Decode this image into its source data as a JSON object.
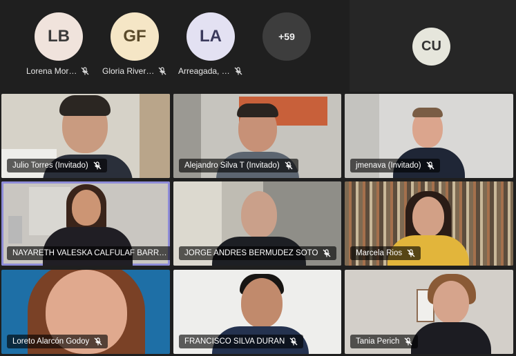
{
  "top_participants": [
    {
      "initials": "LB",
      "name": "Lorena Mor…",
      "color": "#f0e3dc"
    },
    {
      "initials": "GF",
      "name": "Gloria River…",
      "color": "#f5e6c6"
    },
    {
      "initials": "LA",
      "name": "Arreagada, …",
      "color": "#e3e1f2"
    }
  ],
  "more_count": "+59",
  "self_initials": "CU",
  "tiles": [
    {
      "name": "Julio Torres (Invitado)"
    },
    {
      "name": "Alejandro Silva T (Invitado)"
    },
    {
      "name": "jmenava (Invitado)"
    },
    {
      "name": "NAYARETH VALESKA CALFULAF BARR…"
    },
    {
      "name": "JORGE ANDRES BERMUDEZ SOTO"
    },
    {
      "name": "Marcela Rios"
    },
    {
      "name": "Loreto Alarcón Godoy"
    },
    {
      "name": "FRANCISCO SILVA DURAN"
    },
    {
      "name": "Tania Perich"
    }
  ]
}
